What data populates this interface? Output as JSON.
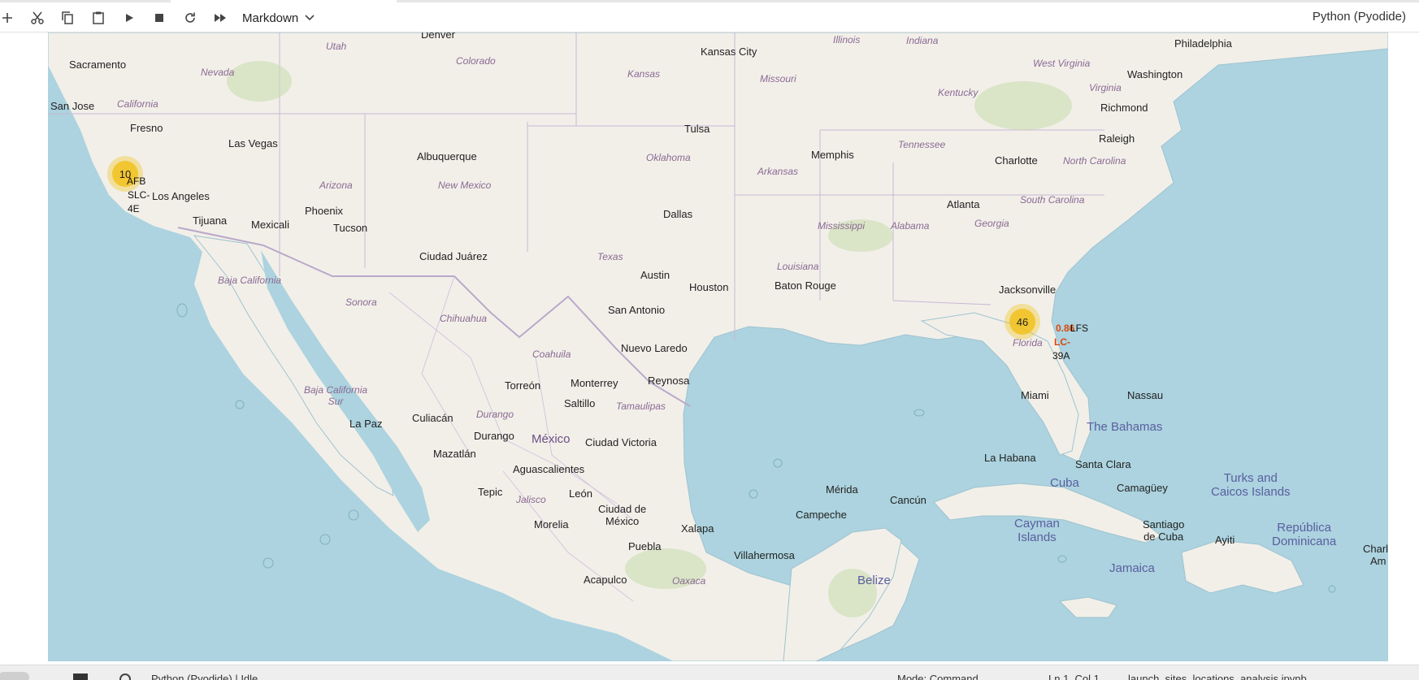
{
  "toolbar": {
    "cell_type": "Markdown",
    "kernel_name": "Python (Pyodide)",
    "buttons": [
      {
        "name": "add-cell-button",
        "icon": "plus-icon"
      },
      {
        "name": "cut-button",
        "icon": "scissors-icon"
      },
      {
        "name": "copy-button",
        "icon": "copy-icon"
      },
      {
        "name": "paste-button",
        "icon": "clipboard-icon"
      },
      {
        "name": "run-button",
        "icon": "play-icon"
      },
      {
        "name": "stop-button",
        "icon": "stop-icon"
      },
      {
        "name": "restart-button",
        "icon": "refresh-icon"
      },
      {
        "name": "restart-run-all-button",
        "icon": "fast-forward-icon"
      }
    ]
  },
  "map": {
    "colors": {
      "water": "#acd3df",
      "land": "#f2efe9",
      "border": "#b9a9c9",
      "cluster": "#f1c21e"
    },
    "cities": {
      "denver": "Denver",
      "sacramento": "Sacramento",
      "san_jose": "San Jose",
      "fresno": "Fresno",
      "las_vegas": "Las Vegas",
      "los_angeles": "Los Angeles",
      "tijuana": "Tijuana",
      "mexicali": "Mexicali",
      "phoenix": "Phoenix",
      "tucson": "Tucson",
      "albuquerque": "Albuquerque",
      "kansas_city": "Kansas City",
      "tulsa": "Tulsa",
      "memphis": "Memphis",
      "dallas": "Dallas",
      "ciudad_juarez": "Ciudad Juárez",
      "austin": "Austin",
      "houston": "Houston",
      "baton_rouge": "Baton Rouge",
      "san_antonio": "San Antonio",
      "nuevo_laredo": "Nuevo Laredo",
      "reynosa": "Reynosa",
      "torreon": "Torreón",
      "monterrey": "Monterrey",
      "saltillo": "Saltillo",
      "culiacan": "Culiacán",
      "la_paz": "La Paz",
      "durango": "Durango",
      "mazatlan": "Mazatlán",
      "ciudad_victoria": "Ciudad Victoria",
      "aguascalientes": "Aguascalientes",
      "tepic": "Tepic",
      "leon": "León",
      "ciudad_de_mexico": "Ciudad de\nMéxico",
      "morelia": "Morelia",
      "puebla": "Puebla",
      "xalapa": "Xalapa",
      "acapulco": "Acapulco",
      "villahermosa": "Villahermosa",
      "merida": "Mérida",
      "campeche": "Campeche",
      "cancun": "Cancún",
      "philadelphia": "Philadelphia",
      "washington": "Washington",
      "richmond": "Richmond",
      "raleigh": "Raleigh",
      "charlotte": "Charlotte",
      "atlanta": "Atlanta",
      "jacksonville": "Jacksonville",
      "miami": "Miami",
      "nassau": "Nassau",
      "la_habana": "La Habana",
      "santa_clara": "Santa Clara",
      "camaguey": "Camagüey",
      "santiago_de_cuba": "Santiago\nde Cuba",
      "ayiti": "Ayiti",
      "charl": "Charl",
      "am": "Am"
    },
    "regions": {
      "utah": "Utah",
      "colorado": "Colorado",
      "nevada": "Nevada",
      "california": "California",
      "arizona": "Arizona",
      "new_mexico": "New Mexico",
      "kansas": "Kansas",
      "missouri": "Missouri",
      "oklahoma": "Oklahoma",
      "arkansas": "Arkansas",
      "texas": "Texas",
      "louisiana": "Louisiana",
      "mississippi": "Mississippi",
      "alabama": "Alabama",
      "georgia": "Georgia",
      "tennessee": "Tennessee",
      "kentucky": "Kentucky",
      "illinois": "Illinois",
      "indiana": "Indiana",
      "west_virginia": "West Virginia",
      "virginia": "Virginia",
      "north_carolina": "North Carolina",
      "south_carolina": "South Carolina",
      "florida": "Florida",
      "baja_california": "Baja California",
      "baja_california_sur": "Baja California\nSur",
      "sonora": "Sonora",
      "chihuahua": "Chihuahua",
      "coahuila": "Coahuila",
      "durango_state": "Durango",
      "tamaulipas": "Tamaulipas",
      "jalisco": "Jalisco",
      "oaxaca": "Oaxaca"
    },
    "countries": {
      "mexico": "México",
      "the_bahamas": "The Bahamas",
      "cuba": "Cuba",
      "cayman": "Cayman\nIslands",
      "jamaica": "Jamaica",
      "turks": "Turks and\nCaicos Islands",
      "dominicana": "República\nDominicana",
      "belize": "Belize"
    },
    "clusters": [
      {
        "id": "west",
        "count": "10"
      },
      {
        "id": "east",
        "count": "46"
      }
    ],
    "markers": {
      "west": [
        "AFB",
        "SLC-",
        "4E"
      ],
      "east": [
        "0.86",
        "LFS",
        "LC-",
        "39A"
      ]
    }
  },
  "statusbar": {
    "kernel_status": "Python (Pyodide) | Idle",
    "mode": "Mode: Command",
    "position": "Ln 1, Col 1",
    "file": "launch_sites_locations_analysis.ipynb"
  }
}
